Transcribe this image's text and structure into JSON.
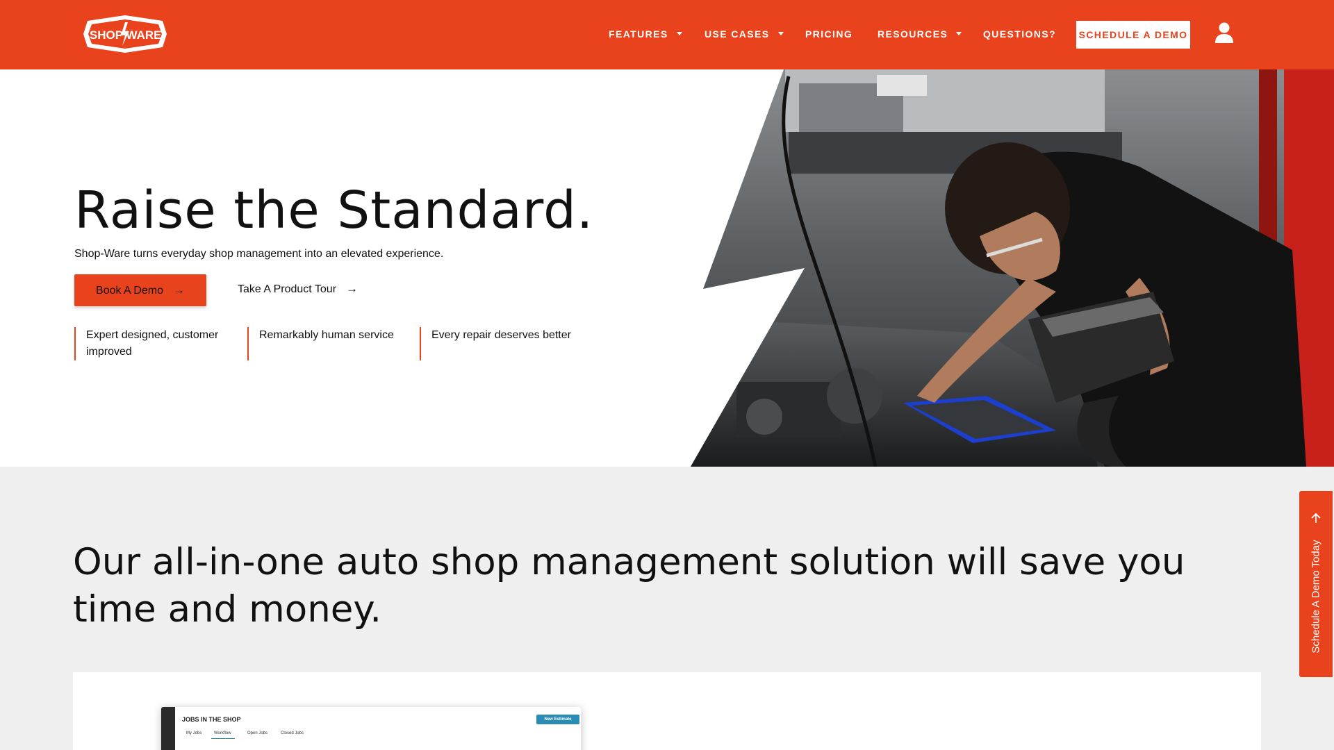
{
  "brand": {
    "logo_text": "SHOP WARE",
    "accent": "#e8431c"
  },
  "nav": {
    "items": [
      {
        "label": "FEATURES",
        "dropdown": true
      },
      {
        "label": "USE CASES",
        "dropdown": true
      },
      {
        "label": "PRICING",
        "dropdown": false
      },
      {
        "label": "RESOURCES",
        "dropdown": true
      },
      {
        "label": "QUESTIONS?",
        "dropdown": false
      }
    ],
    "cta_label": "SCHEDULE A DEMO",
    "account_icon": "user-icon"
  },
  "hero": {
    "title": "Raise the Standard.",
    "subtitle": "Shop-Ware turns everyday shop management into an elevated experience.",
    "primary_button": "Book A Demo",
    "secondary_button": "Take A Product Tour",
    "features": [
      {
        "line1": "Expert designed, customer",
        "line2": "improved"
      },
      {
        "line1": "Remarkably human service",
        "line2": ""
      },
      {
        "line1": "Every repair deserves better",
        "line2": ""
      }
    ]
  },
  "section2": {
    "title": "Our all-in-one auto shop management solution will save you time and money."
  },
  "app_preview": {
    "title": "JOBS IN THE SHOP",
    "new_button": "New Estimate",
    "tabs": [
      "My Jobs",
      "Workflow",
      "Open Jobs",
      "Closed Jobs"
    ]
  },
  "side_tab": {
    "label": "Schedule A Demo Today"
  }
}
